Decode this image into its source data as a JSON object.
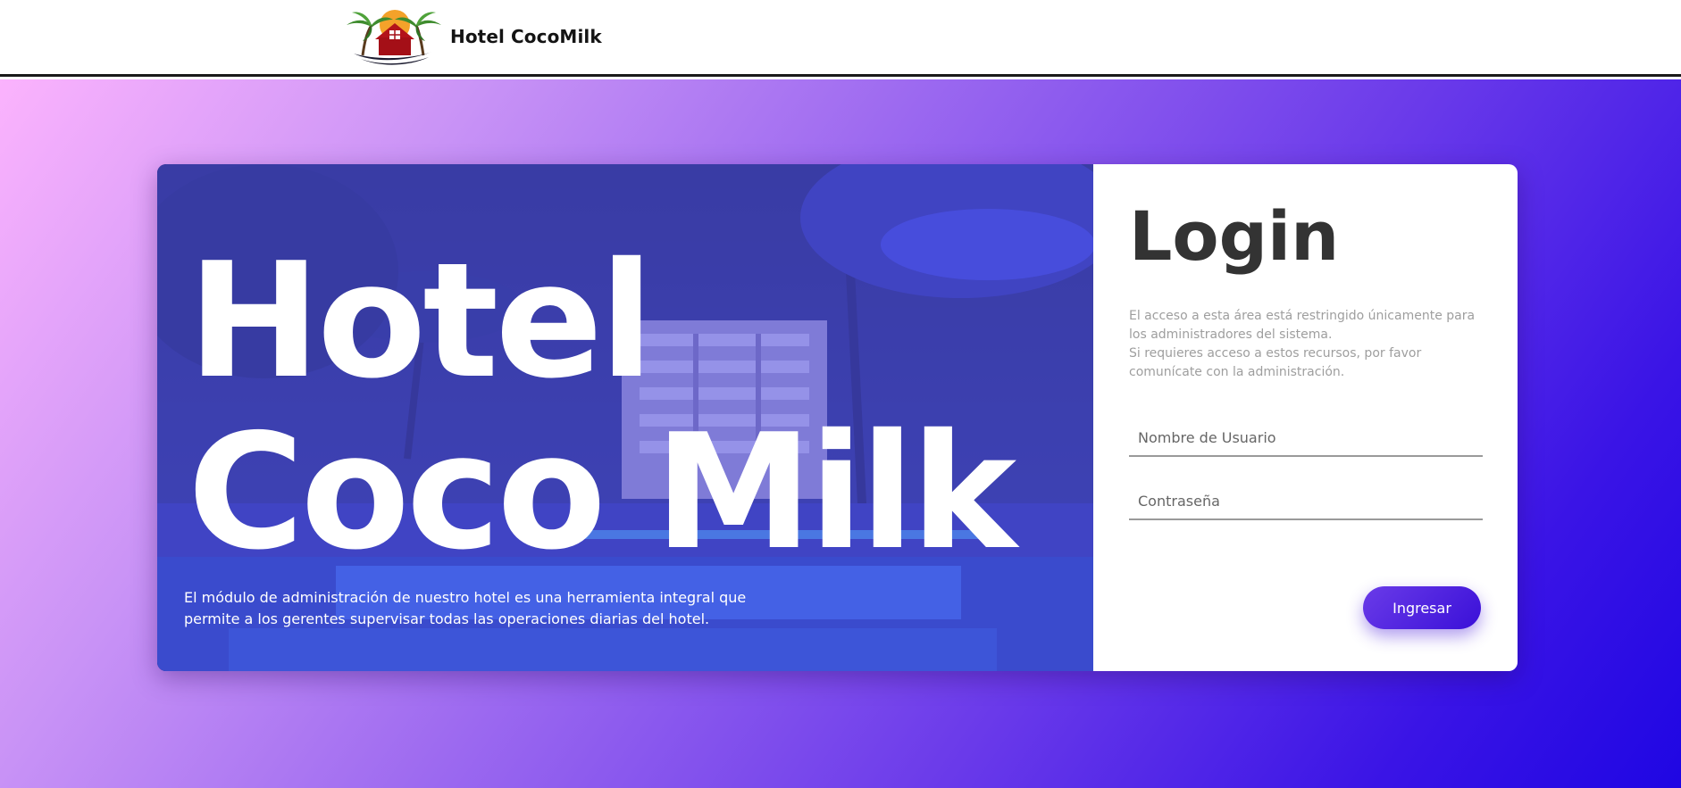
{
  "header": {
    "brand_name": "Hotel CocoMilk",
    "logo_icon": "hotel-palm-sunset-logo"
  },
  "hero": {
    "title_line1": "Hotel",
    "title_line2": "Coco Milk",
    "description": "El módulo de administración de nuestro hotel es una herramienta integral que permite a los gerentes supervisar todas las operaciones diarias del hotel."
  },
  "login": {
    "title": "Login",
    "info_line1": "El acceso a esta área está restringido únicamente para los administradores del sistema.",
    "info_line2": "Si requieres acceso a estos recursos, por favor comunícate con la administración.",
    "username_placeholder": "Nombre de Usuario",
    "password_placeholder": "Contraseña",
    "submit_label": "Ingresar"
  },
  "colors": {
    "gradient_start": "#fbb3fd",
    "gradient_end": "#1f06e3",
    "hero_overlay": "#5256e2",
    "button_start": "#6a3be8",
    "button_end": "#3a10d8",
    "title_text": "#333333",
    "info_text": "#9e9e9e"
  }
}
